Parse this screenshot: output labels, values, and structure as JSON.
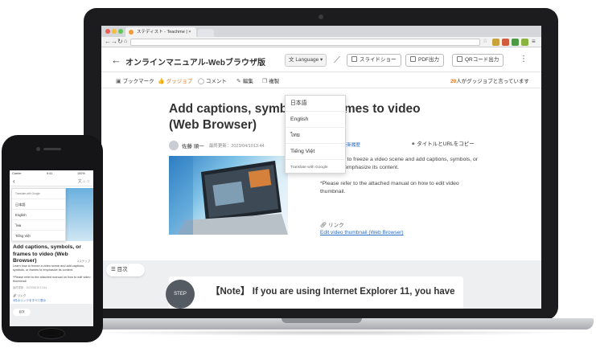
{
  "browser": {
    "tab_title": "ステディスト - Teachme | ×",
    "tab_close": "×"
  },
  "app": {
    "back": "←",
    "title": "オンラインマニュアル-Webブラウザ版",
    "language_button": "Language ▾",
    "language_glyph": "文",
    "slideshow_button": "スライドショー",
    "pdf_button": "PDF出力",
    "qr_button": "QRコード出力",
    "more": "⋮"
  },
  "toolbar": {
    "bookmark": "ブックマーク",
    "gujo": "グッジョブ",
    "comment": "コメント",
    "edit": "編集",
    "copy": "複製",
    "gujo_count_number": "20",
    "gujo_count_text": "人がグッジョブと言っています"
  },
  "language_menu": {
    "items": [
      "日本語",
      "English",
      "ไทย",
      "Tiếng Việt"
    ],
    "google": "Translate with Google"
  },
  "manual": {
    "title": "Add captions, symbols, or frames to video (Web Browser)",
    "author": "佐藤 順一",
    "updated": "最終更新：2023/04/1013:44",
    "history": "更新履歴",
    "copy_title": "タイトルとURLをコピー",
    "description": "Learn how to freeze a video scene and add captions, symbols, or frames to emphasize its content.",
    "note": "*Please refer to the attached manual on how to edit video thumbnail.",
    "link_label": "リンク",
    "link_text": "Edit video thumbnail (Web Browser)",
    "toc": "目次",
    "step_badge": "STEP",
    "step_note": "【Note】 If you are using Internet Explorer 11, you have"
  },
  "phone": {
    "carrier": "Carrier",
    "time": "9:41",
    "battery": "100%",
    "menu_items": [
      "日本語",
      "English",
      "ไทย",
      "Tiếng Việt"
    ],
    "google": "Translate with Google",
    "title": "Add captions, symbols, or frames to video (Web Browser)",
    "steps": "3ステップ",
    "description": "Learn how to freeze a video scene and add captions, symbols, or frames to emphasize its content.",
    "note": "*Please refer to the attached manual on how to edit video thumbnail.",
    "updated": "最終更新：2023/04/10 13:44",
    "link_label": "リンク",
    "link_all": "3件のリンクをすべて表示",
    "toc": "目次"
  },
  "colors": {
    "accent_orange": "#e0741e",
    "link_blue": "#2b6cc4",
    "device_black": "#1c1c1e"
  }
}
